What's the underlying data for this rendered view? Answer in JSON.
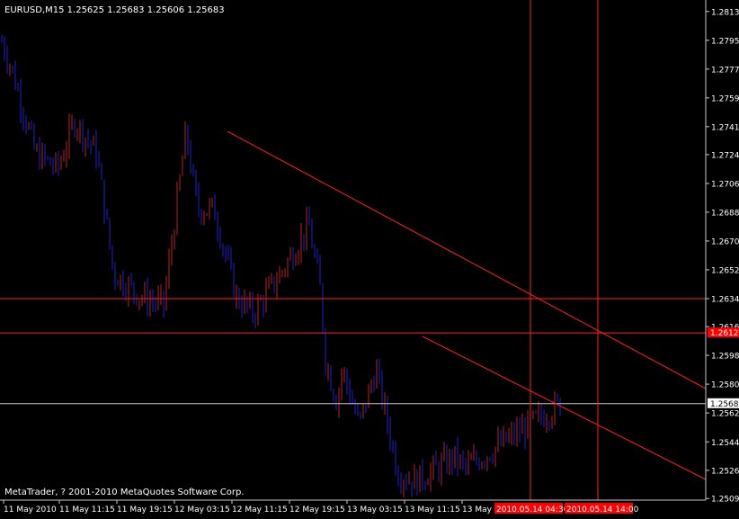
{
  "chart_data": {
    "type": "bar",
    "title": "EURUSD,M15  1.25625 1.25683 1.25606 1.25683",
    "footer": "MetaTrader, ? 2001-2010 MetaQuotes Software Corp.",
    "ylim": [
      1.2508,
      1.2819
    ],
    "y_ticks": [
      "1.28135",
      "1.27955",
      "1.27775",
      "1.27595",
      "1.27415",
      "1.27240",
      "1.27060",
      "1.26880",
      "1.26700",
      "1.26520",
      "1.26340",
      "1.26165",
      "1.25985",
      "1.25805",
      "1.25625",
      "1.25444",
      "1.25266",
      "1.25090"
    ],
    "x_labels": [
      "11 May 2010",
      "11 May 11:15",
      "11 May 19:15",
      "12 May 03:15",
      "12 May 11:15",
      "12 May 19:15",
      "13 May 03:15",
      "13 May 11:15",
      "13 May"
    ],
    "current_price": "1.25683",
    "hline_label": "1.26125",
    "vline_labels": [
      "2010.05.14 04:30",
      "2010.05.14 14:00"
    ],
    "colors": {
      "up": "#b22222",
      "down": "#2020c8",
      "line": "#ff2020",
      "axis": "#c8c8c8",
      "label_bg": "#ff0000",
      "grid_line": "#c8c8c8"
    },
    "key_points": {
      "x_norm": [
        0,
        0.02,
        0.06,
        0.1,
        0.13,
        0.17,
        0.2,
        0.25,
        0.29,
        0.33,
        0.35,
        0.38,
        0.42,
        0.45,
        0.5,
        0.55,
        0.57,
        0.58,
        0.6,
        0.61,
        0.64,
        0.67,
        0.71,
        0.74,
        0.79,
        0.81,
        0.83,
        1
      ],
      "prices": [
        1.2795,
        1.2775,
        1.2725,
        1.2715,
        1.2745,
        1.2725,
        1.265,
        1.2635,
        1.263,
        1.2738,
        1.269,
        1.269,
        1.2635,
        1.2625,
        1.265,
        1.268,
        1.264,
        1.2595,
        1.257,
        1.259,
        1.2555,
        1.259,
        1.2525,
        1.252,
        1.253,
        1.2535,
        1.2528,
        1.2568
      ]
    }
  }
}
